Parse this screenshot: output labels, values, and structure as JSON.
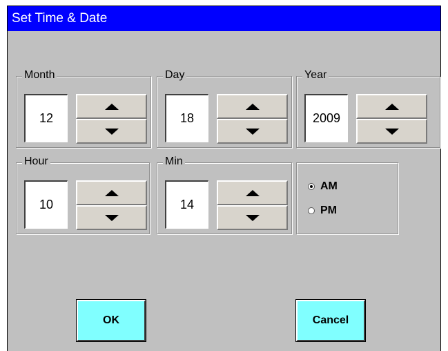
{
  "window": {
    "title": "Set Time & Date"
  },
  "month": {
    "label": "Month",
    "value": "12"
  },
  "day": {
    "label": "Day",
    "value": "18"
  },
  "year": {
    "label": "Year",
    "value": "2009"
  },
  "hour": {
    "label": "Hour",
    "value": "10"
  },
  "minute": {
    "label": "Min",
    "value": "14"
  },
  "ampm": {
    "options": [
      "AM",
      "PM"
    ],
    "selected": "AM"
  },
  "buttons": {
    "ok": "OK",
    "cancel": "Cancel"
  },
  "colors": {
    "title_bg": "#0000ff",
    "panel_bg": "#c0c0c0",
    "action_btn": "#80ffff",
    "spin_btn": "#d8d4cc"
  }
}
